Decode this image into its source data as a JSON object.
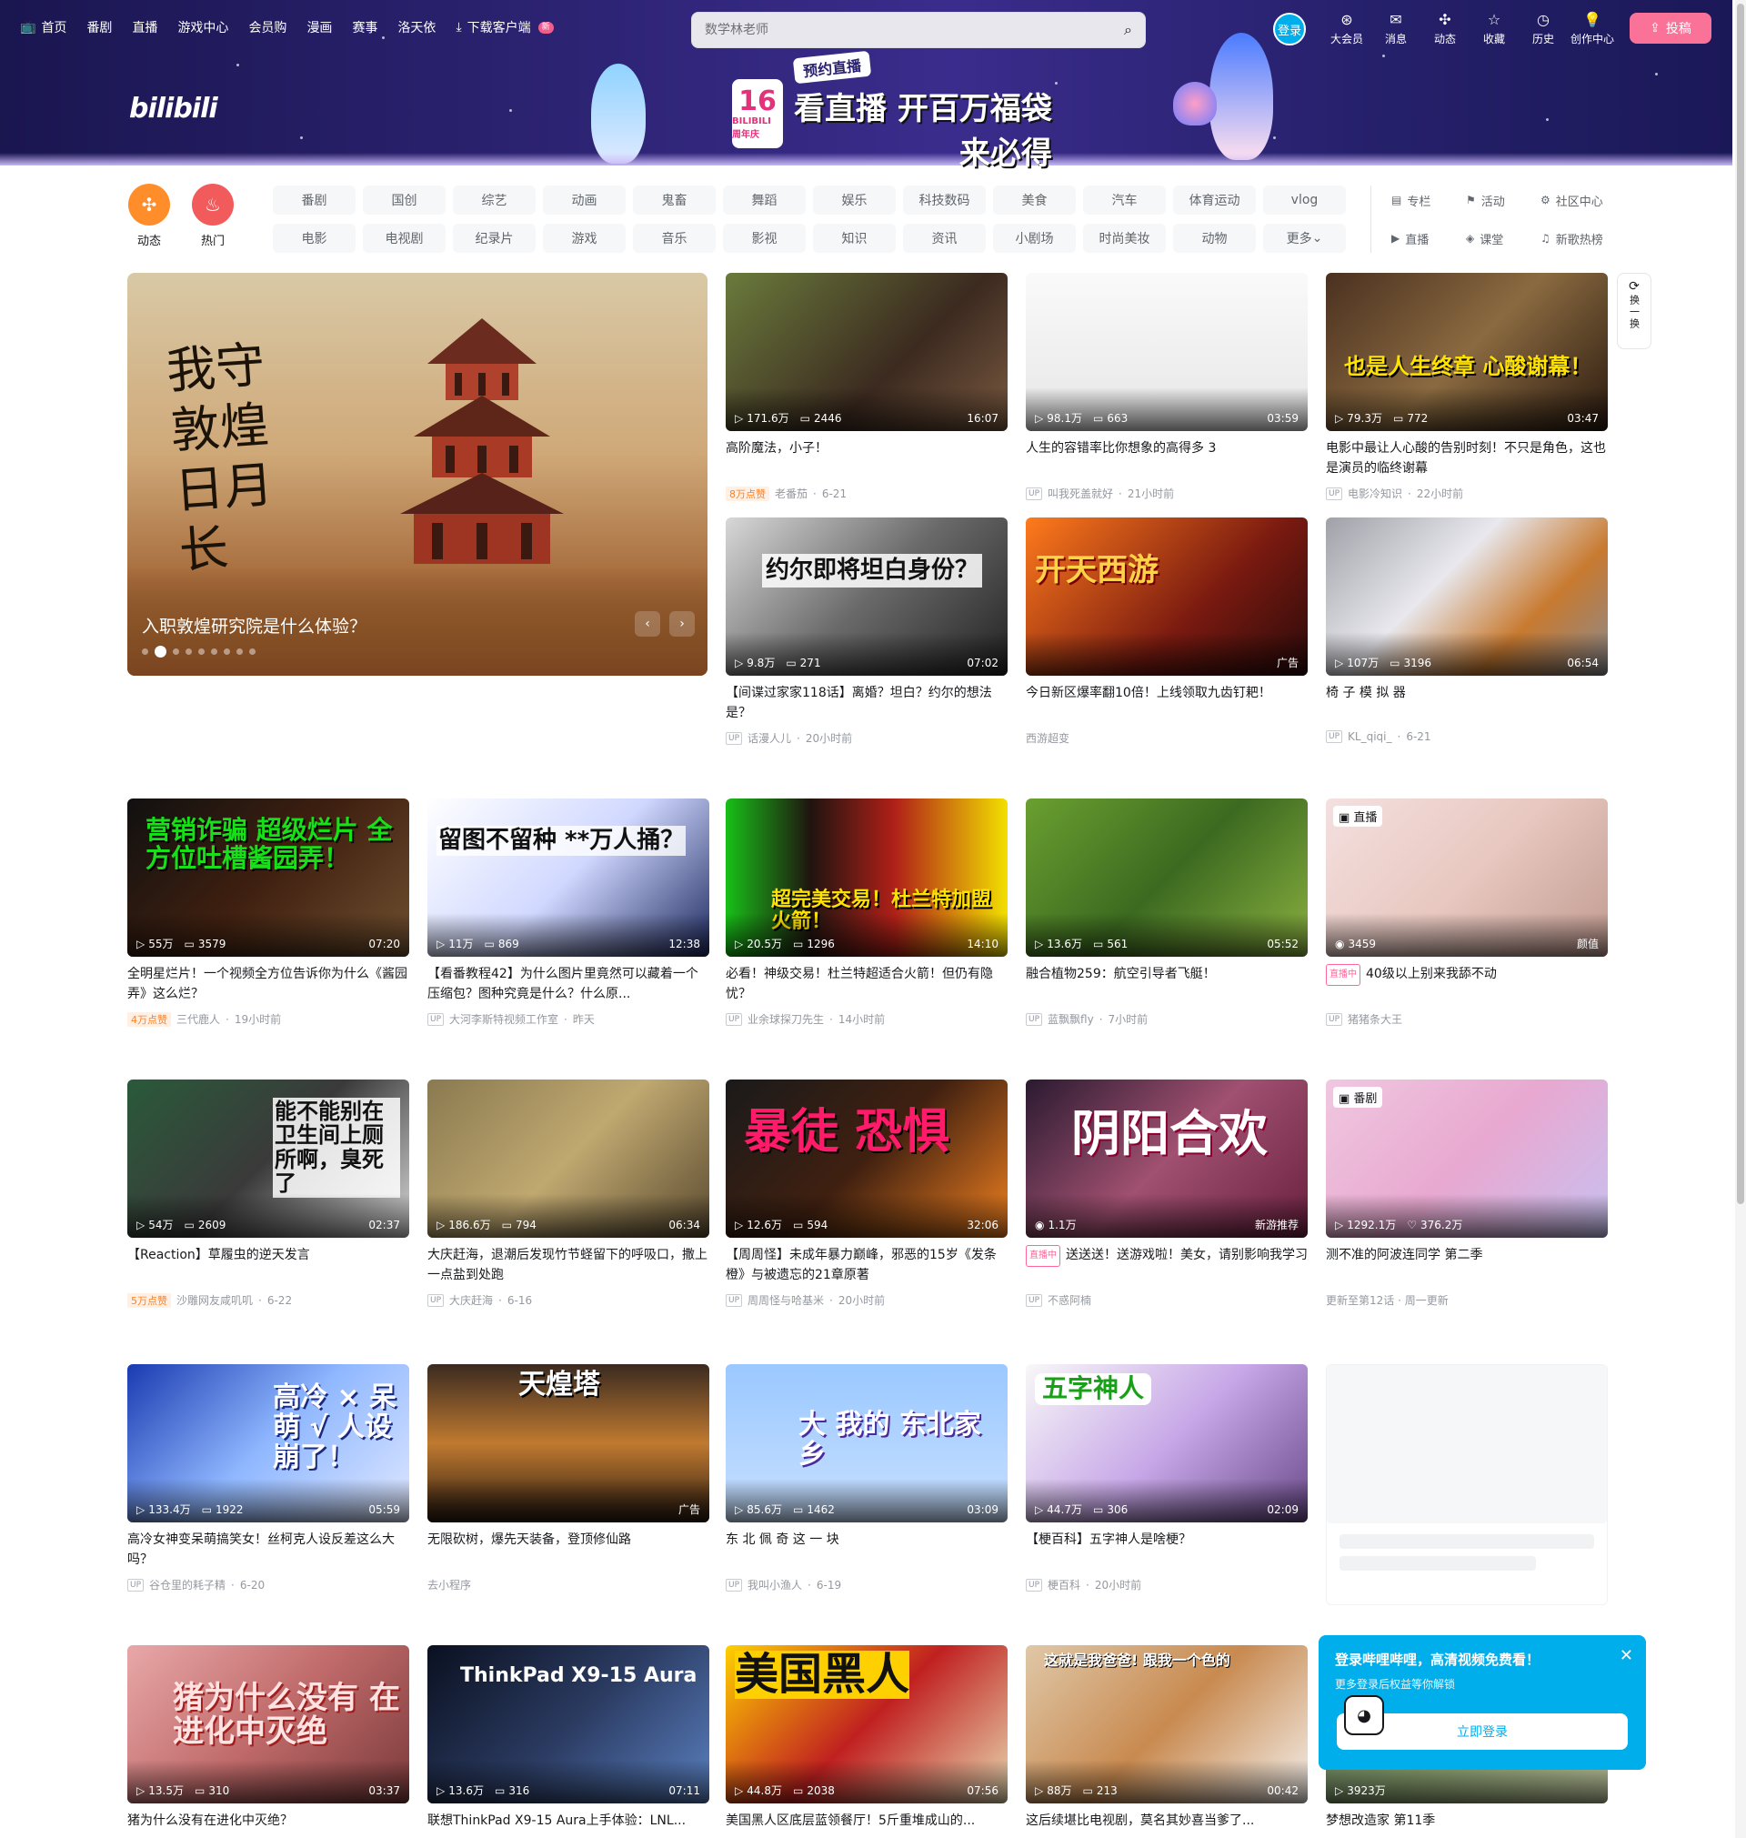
{
  "topnav": {
    "items": [
      "首页",
      "番剧",
      "直播",
      "游戏中心",
      "会员购",
      "漫画",
      "赛事",
      "洛天依",
      "下载客户端"
    ],
    "new_badge": "新"
  },
  "search": {
    "placeholder": "数学林老师"
  },
  "rightnav": {
    "login": "登录",
    "items": [
      "大会员",
      "消息",
      "动态",
      "收藏",
      "历史",
      "创作中心"
    ],
    "upload": "投稿"
  },
  "banner": {
    "logo": "bilibili",
    "anniv_num": "16",
    "anniv_label": "BILIBILI 周年庆",
    "tag": "预约直播",
    "line1": "看直播 开百万福袋",
    "line2": "来必得"
  },
  "channels": {
    "big": [
      {
        "label": "动态",
        "icon": "pinwheel-icon",
        "color": "#ff8d29"
      },
      {
        "label": "热门",
        "icon": "flame-icon",
        "color": "#f15b5b"
      }
    ],
    "grid": [
      "番剧",
      "国创",
      "综艺",
      "动画",
      "鬼畜",
      "舞蹈",
      "娱乐",
      "科技数码",
      "美食",
      "汽车",
      "体育运动",
      "vlog",
      "电影",
      "电视剧",
      "纪录片",
      "游戏",
      "音乐",
      "影视",
      "知识",
      "资讯",
      "小剧场",
      "时尚美妆",
      "动物",
      "更多"
    ],
    "side": [
      {
        "icon": "column-icon",
        "label": "专栏"
      },
      {
        "icon": "flag-icon",
        "label": "活动"
      },
      {
        "icon": "community-icon",
        "label": "社区中心"
      },
      {
        "icon": "live-icon",
        "label": "直播"
      },
      {
        "icon": "class-icon",
        "label": "课堂"
      },
      {
        "icon": "music-icon",
        "label": "新歌热榜"
      }
    ]
  },
  "carousel": {
    "title": "入职敦煌研究院是什么体验？",
    "calligraphy": "我守敦煌日月长",
    "slide_count": 9,
    "active_slide": 2
  },
  "refresh": {
    "label": "换一换"
  },
  "cards": [
    {
      "title": "高阶魔法，小子！",
      "views": "171.6万",
      "danmaku": "2446",
      "duration": "16:07",
      "likes": "8万点赞",
      "author": "老番茄",
      "date": "6-21"
    },
    {
      "title": "人生的容错率比你想象的高得多 3",
      "views": "98.1万",
      "danmaku": "663",
      "duration": "03:59",
      "author": "叫我死盖就好",
      "date": "21小时前"
    },
    {
      "title": "电影中最让人心酸的告别时刻！不只是角色，这也是演员的临终谢幕",
      "views": "79.3万",
      "danmaku": "772",
      "duration": "03:47",
      "author": "电影冷知识",
      "date": "22小时前",
      "overlay": "也是人生终章 心酸谢幕！"
    },
    {
      "title": "【间谍过家家118话】离婚？坦白？约尔的想法是？",
      "views": "9.8万",
      "danmaku": "271",
      "duration": "07:02",
      "author": "话漫人儿",
      "date": "20小时前",
      "overlay": "约尔即将坦白身份？"
    },
    {
      "title": "今日新区爆率翻10倍！上线领取九齿钉耙！",
      "ad": "广告",
      "author": "西游超变",
      "overlay": "开天西游"
    },
    {
      "title": "椅 子 模 拟 器",
      "views": "107万",
      "danmaku": "3196",
      "duration": "06:54",
      "author": "KL_qiqi_",
      "date": "6-21"
    },
    {
      "title": "全明星烂片！一个视频全方位告诉你为什么《酱园弄》这么烂？",
      "views": "55万",
      "danmaku": "3579",
      "duration": "07:20",
      "likes": "4万点赞",
      "author": "三代鹿人",
      "date": "19小时前",
      "overlay": "营销诈骗 超级烂片 全方位吐槽酱园弄！"
    },
    {
      "title": "【看番教程42】为什么图片里竟然可以藏着一个压缩包？图种究竟是什么？什么原...",
      "views": "11万",
      "danmaku": "869",
      "duration": "12:38",
      "author": "大河李斯特视频工作室",
      "date": "昨天",
      "overlay": "留图不留种 **万人捅？"
    },
    {
      "title": "必看！神级交易！杜兰特超适合火箭！但仍有隐忧？",
      "views": "20.5万",
      "danmaku": "1296",
      "duration": "14:10",
      "author": "业余球探刀先生",
      "date": "14小时前",
      "overlay": "超完美交易！杜兰特加盟火箭！"
    },
    {
      "title": "融合植物259：航空引导者飞艇！",
      "views": "13.6万",
      "danmaku": "561",
      "duration": "05:52",
      "author": "蓝飘飘fly",
      "date": "7小时前"
    },
    {
      "title": "40级以上别来我舔不动",
      "live": true,
      "live_label": "直播中",
      "tag": "直播",
      "viewers": "3459",
      "category": "颜值",
      "author": "猪猪条大王"
    },
    {
      "title": "【Reaction】草履虫的逆天发言",
      "views": "54万",
      "danmaku": "2609",
      "duration": "02:37",
      "likes": "5万点赞",
      "author": "沙雕网友咸叽叽",
      "date": "6-22",
      "overlay": "能不能别在卫生间上厕所啊，臭死了"
    },
    {
      "title": "大庆赶海，退潮后发现竹节蛏留下的呼吸口，撒上一点盐到处跑",
      "views": "186.6万",
      "danmaku": "794",
      "duration": "06:34",
      "author": "大庆赶海",
      "date": "6-16"
    },
    {
      "title": "【周周怪】未成年暴力巅峰，邪恶的15岁《发条橙》与被遗忘的21章原著",
      "views": "12.6万",
      "danmaku": "594",
      "duration": "32:06",
      "author": "周周怪与哈基米",
      "date": "20小时前",
      "overlay": "暴徒 恐惧"
    },
    {
      "title": "送送送！送游戏啦！美女，请别影响我学习",
      "live": true,
      "live_label": "直播中",
      "viewers": "1.1万",
      "category": "新游推荐",
      "author": "不惑阿楠",
      "overlay": "阴阳合欢"
    },
    {
      "title": "测不准的阿波连同学 第二季",
      "tag": "番剧",
      "views": "1292.1万",
      "follows": "376.2万",
      "update": "更新至第12话 · 周一更新"
    },
    {
      "title": "高冷女神变呆萌搞笑女！丝柯克人设反差这么大吗？",
      "views": "133.4万",
      "danmaku": "1922",
      "duration": "05:59",
      "author": "谷仓里的耗子精",
      "date": "6-20",
      "overlay": "高冷 × 呆萌 √ 人设崩了！"
    },
    {
      "title": "无限砍树，爆先天装备，登顶修仙路",
      "ad": "广告",
      "author": "去小程序",
      "overlay": "天煌塔"
    },
    {
      "title": "东 北 佩 奇 这 一 块",
      "views": "85.6万",
      "danmaku": "1462",
      "duration": "03:09",
      "author": "我叫小渔人",
      "date": "6-19",
      "overlay": "大 我的 东北家乡"
    },
    {
      "title": "【梗百科】五字神人是啥梗？",
      "views": "44.7万",
      "danmaku": "306",
      "duration": "02:09",
      "author": "梗百科",
      "date": "20小时前",
      "overlay": "五字神人"
    },
    {
      "title": "猪为什么没有在进化中灭绝？",
      "views": "13.5万",
      "danmaku": "310",
      "duration": "03:37",
      "overlay": "猪为什么没有 在进化中灭绝"
    },
    {
      "title": "联想ThinkPad X9-15 Aura上手体验：LNL...",
      "views": "13.6万",
      "danmaku": "316",
      "duration": "07:11",
      "overlay": "ThinkPad X9-15 Aura"
    },
    {
      "title": "美国黑人区底层蓝领餐厅！5斤重堆成山的...",
      "views": "44.8万",
      "danmaku": "2038",
      "duration": "07:56",
      "overlay": "美国黑人"
    },
    {
      "title": "这后续堪比电视剧，莫名其妙喜当爹了...",
      "views": "88万",
      "danmaku": "213",
      "duration": "00:42",
      "overlay": "这就是我爸爸!  跟我一个色的"
    },
    {
      "title": "梦想改造家 第11季",
      "views": "3923万"
    }
  ],
  "loginpop": {
    "title": "登录哔哩哔哩，高清视频免费看！",
    "sub": "更多登录后权益等你解锁",
    "button": "立即登录"
  },
  "colors": {
    "brand": "#00aeec",
    "pink": "#fb7299",
    "banner": "#2b2270"
  }
}
